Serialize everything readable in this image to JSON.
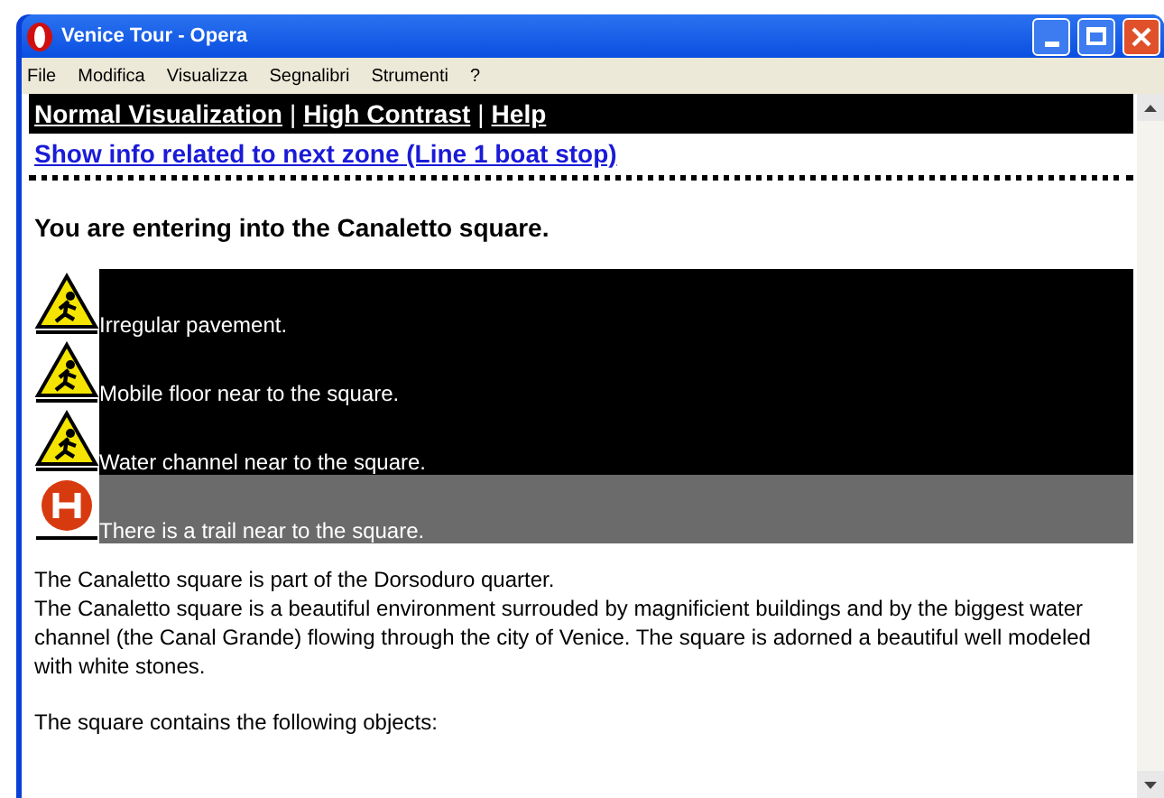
{
  "window": {
    "title": "Venice Tour - Opera"
  },
  "menu": [
    "File",
    "Modifica",
    "Visualizza",
    "Segnalibri",
    "Strumenti",
    "?"
  ],
  "nav_links": [
    {
      "label": "Normal Visualization"
    },
    {
      "label": "High Contrast"
    },
    {
      "label": "Help"
    }
  ],
  "nav_separator": "|",
  "next_zone_link": "Show info related to next zone (Line 1 boat stop)",
  "heading": "You are entering into the Canaletto square.",
  "alerts": [
    {
      "kind": "warning",
      "text": "Irregular pavement."
    },
    {
      "kind": "warning",
      "text": "Mobile floor near to the square."
    },
    {
      "kind": "warning",
      "text": "Water channel near to the square."
    },
    {
      "kind": "hospital",
      "text": "There is a trail near to the square."
    }
  ],
  "paragraphs": [
    "The Canaletto square is part of the Dorsoduro quarter.\nThe Canaletto square is a beautiful environment surrouded by magnificient buildings and by the biggest water channel (the Canal Grande) flowing through the city of Venice. The square is adorned a beautiful well modeled with white stones.",
    "The square contains the following objects:"
  ]
}
